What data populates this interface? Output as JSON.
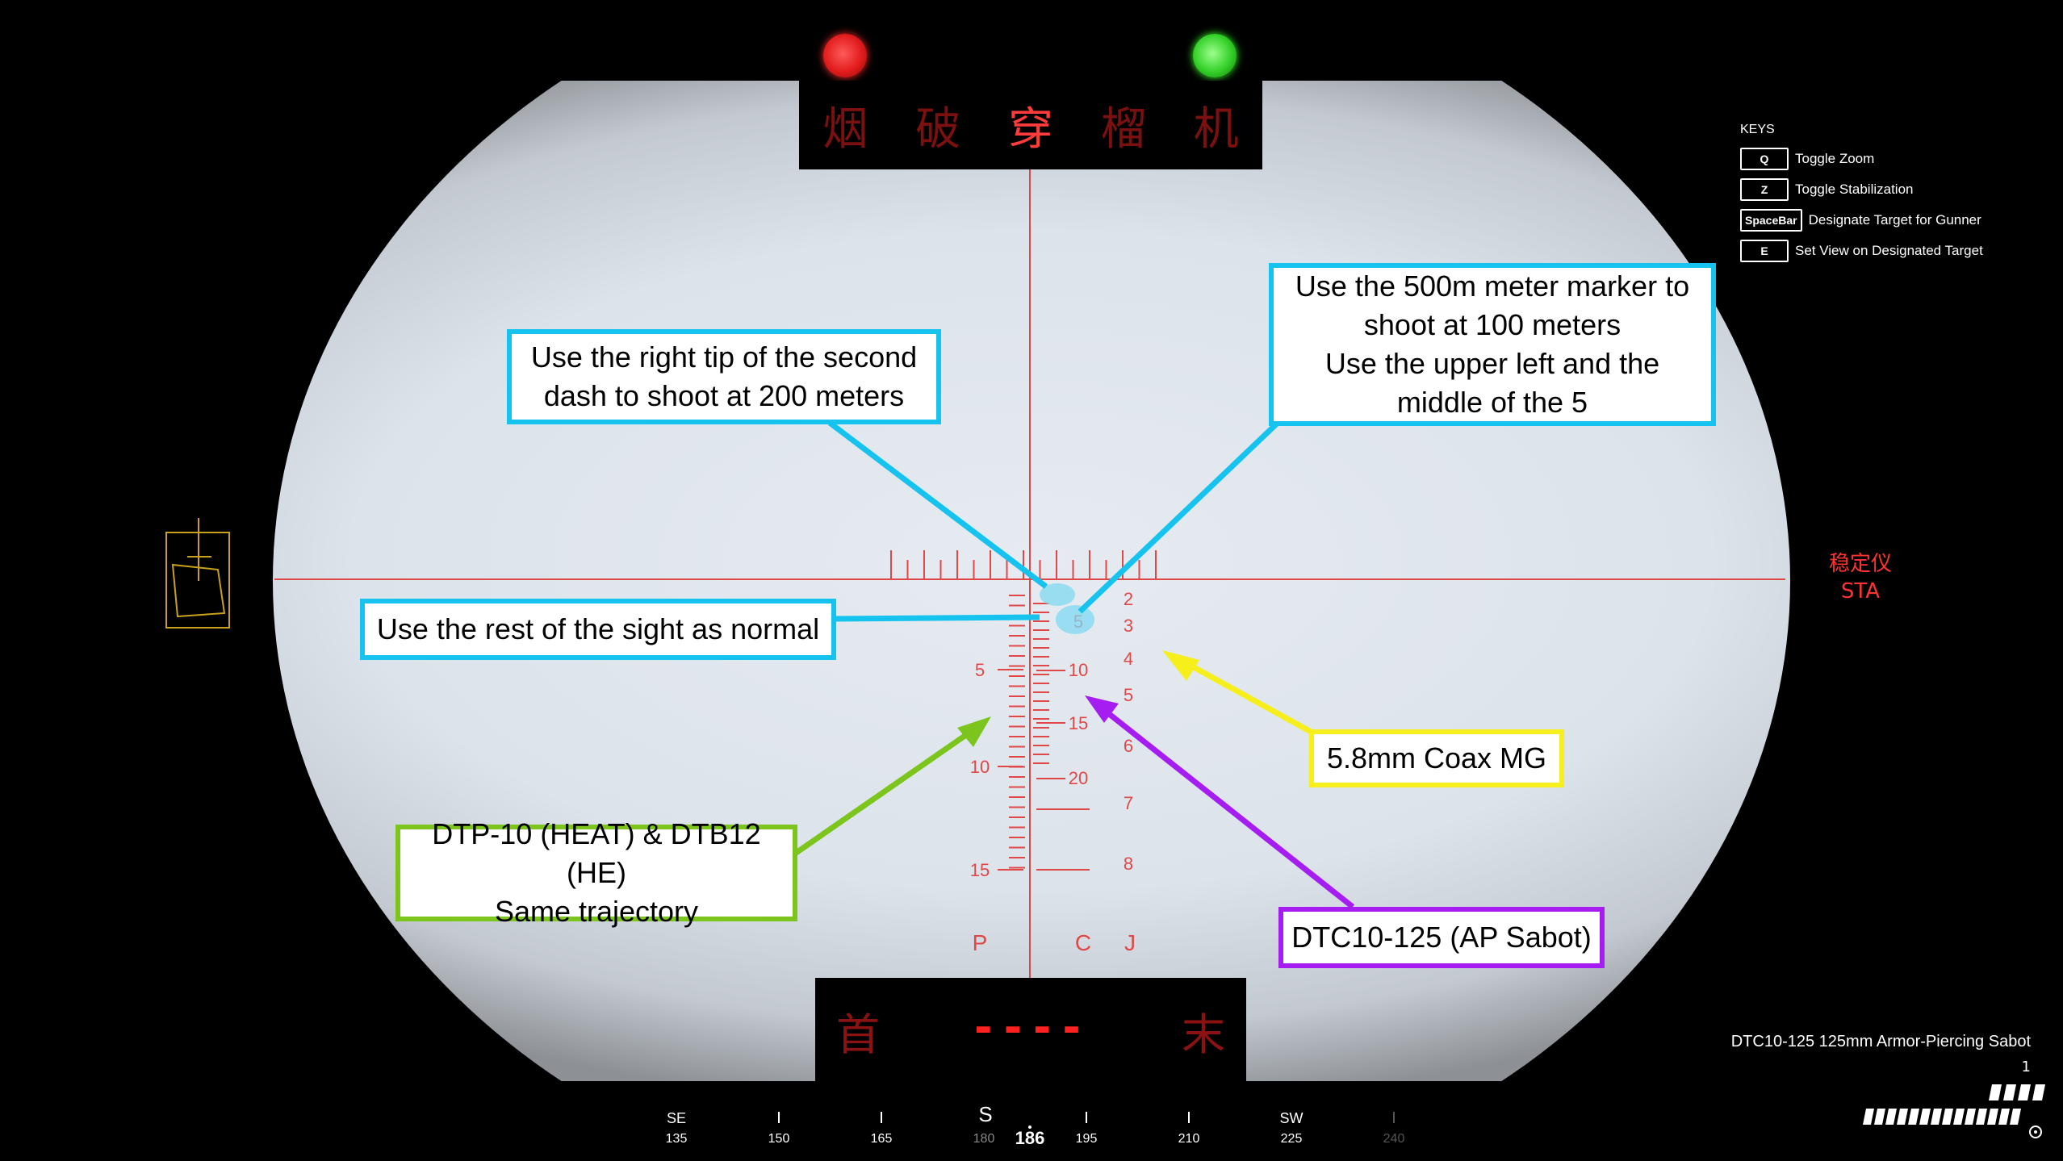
{
  "lamps": {
    "left_color": "#e21c1c",
    "right_color": "#33d027"
  },
  "ammo_selector": {
    "chars": [
      "烟",
      "破",
      "穿",
      "榴",
      "机"
    ],
    "active_index": 2
  },
  "bottom_panel": {
    "first": "首",
    "dashes": "----",
    "last": "末"
  },
  "keys": {
    "title": "KEYS",
    "items": [
      {
        "key": "Q",
        "action": "Toggle Zoom"
      },
      {
        "key": "Z",
        "action": "Toggle Stabilization"
      },
      {
        "key": "SpaceBar",
        "action": "Designate Target for Gunner"
      },
      {
        "key": "E",
        "action": "Set View on Designated Target"
      }
    ]
  },
  "stabilizer": {
    "cn": "稳定仪",
    "en": "STA"
  },
  "ammo_info": {
    "name": "DTC10-125 125mm Armor-Piercing Sabot",
    "count": "1"
  },
  "reticle": {
    "coax_numbers": [
      "2",
      "3",
      "4",
      "5",
      "6",
      "7",
      "8"
    ],
    "sabot_numbers": [
      "5",
      "10",
      "15",
      "20"
    ],
    "heat_numbers": [
      "5",
      "10",
      "15"
    ],
    "column_letters": [
      "P",
      "C",
      "J"
    ]
  },
  "callouts": {
    "c200m": "Use the right tip of the second\ndash to shoot at 200 meters",
    "c100m": "Use the 500m meter marker to\nshoot at 100 meters\nUse the upper left and the\nmiddle of the 5",
    "rest": "Use the rest of the sight as normal",
    "coax": "5.8mm Coax MG",
    "heat": "DTP-10 (HEAT) & DTB12 (HE)\nSame trajectory",
    "sabot": "DTC10-125 (AP Sabot)"
  },
  "compass": {
    "heading": "186",
    "cardinal": "S",
    "marks": [
      {
        "deg": "135",
        "label": "SE"
      },
      {
        "deg": "150",
        "label": ""
      },
      {
        "deg": "165",
        "label": ""
      },
      {
        "deg": "180",
        "label": "S"
      },
      {
        "deg": "195",
        "label": ""
      },
      {
        "deg": "210",
        "label": ""
      },
      {
        "deg": "225",
        "label": "SW"
      },
      {
        "deg": "240",
        "label": ""
      }
    ]
  },
  "colors": {
    "reticle": "#e04848",
    "callout_cyan": "#16c3ee",
    "callout_yellow": "#f7ef1c",
    "callout_green": "#7cc51c",
    "callout_purple": "#a51df0"
  }
}
